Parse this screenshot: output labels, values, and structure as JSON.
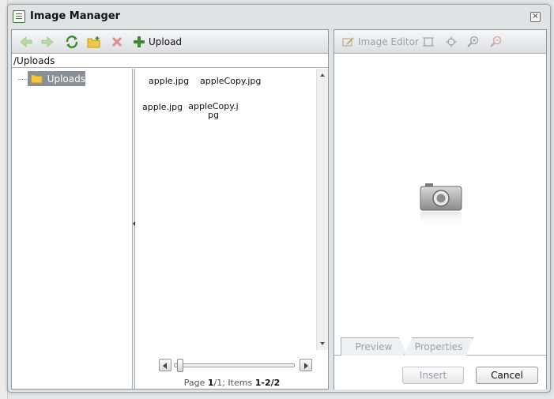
{
  "dialog": {
    "title": "Image Manager",
    "close_label": "×"
  },
  "toolbar": {
    "back_icon": "arrow-left-icon",
    "forward_icon": "arrow-right-icon",
    "refresh_icon": "refresh-icon",
    "new_folder_icon": "new-folder-icon",
    "delete_icon": "delete-icon",
    "upload_label": "Upload"
  },
  "path": "/Uploads",
  "tree": {
    "items": [
      {
        "label": "Uploads",
        "selected": true
      }
    ]
  },
  "files": [
    {
      "name": "apple.jpg"
    },
    {
      "name": "appleCopy.jpg"
    },
    {
      "name": "apple.jpg"
    },
    {
      "name_line1": "appleCopy.j",
      "name_line2": "pg"
    }
  ],
  "pager": {
    "page_label": "Page",
    "page": "1",
    "pages": "/1",
    "items_label": "; Items",
    "range": "1-2/2"
  },
  "right_toolbar": {
    "image_editor_label": "Image Editor"
  },
  "tabs": [
    {
      "label": "Preview"
    },
    {
      "label": "Properties"
    }
  ],
  "footer": {
    "insert_label": "Insert",
    "cancel_label": "Cancel"
  },
  "colors": {
    "accent": "#3c8a2e",
    "selected_node": "#8a8f95",
    "panel_border": "#8f989f"
  }
}
